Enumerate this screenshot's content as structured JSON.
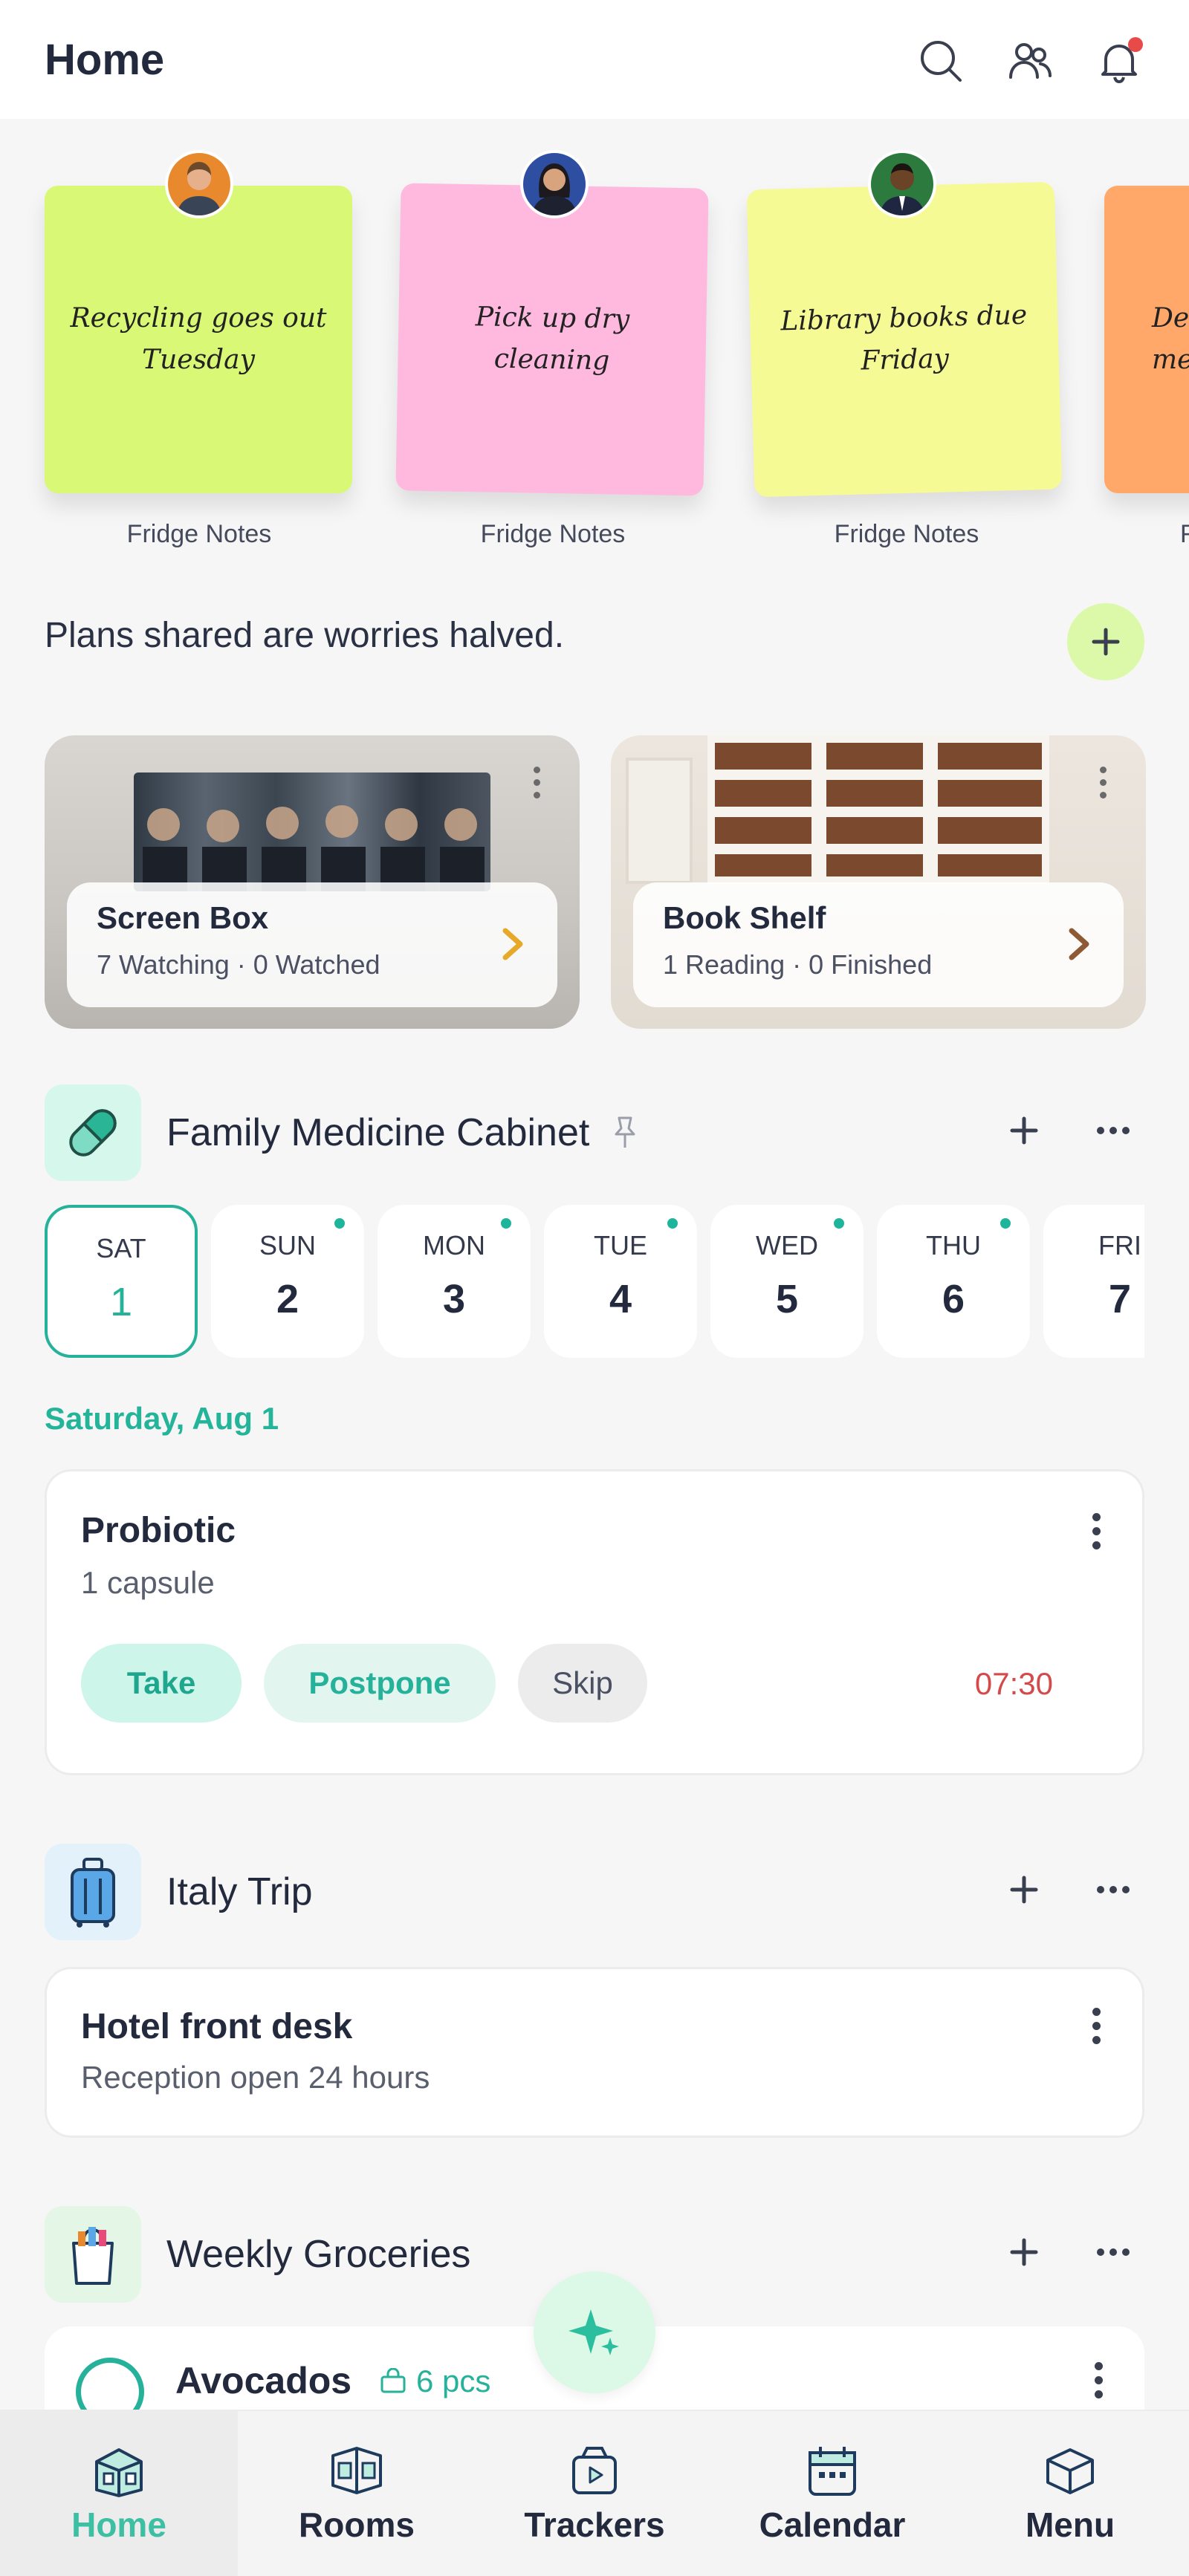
{
  "header": {
    "title": "Home"
  },
  "fridge_notes": [
    {
      "text": "Recycling goes out Tuesday",
      "caption": "Fridge Notes",
      "color": "#d9f876"
    },
    {
      "text": "Pick up dry cleaning",
      "caption": "Fridge Notes",
      "color": "#ffb9de"
    },
    {
      "text": "Library books due Friday",
      "caption": "Fridge Notes",
      "color": "#f6fa95"
    },
    {
      "text": "Dentist me",
      "caption": "F",
      "color": "#ffa86a"
    }
  ],
  "tagline": "Plans shared are worries halved.",
  "media_cards": [
    {
      "title": "Screen Box",
      "subtitle": "7 Watching · 0 Watched",
      "chevron_color": "#e6a92a"
    },
    {
      "title": "Book Shelf",
      "subtitle": "1 Reading · 0 Finished",
      "chevron_color": "#8d5a35"
    }
  ],
  "medicine": {
    "title": "Family Medicine Cabinet",
    "days": [
      {
        "name": "SAT",
        "num": "1"
      },
      {
        "name": "SUN",
        "num": "2"
      },
      {
        "name": "MON",
        "num": "3"
      },
      {
        "name": "TUE",
        "num": "4"
      },
      {
        "name": "WED",
        "num": "5"
      },
      {
        "name": "THU",
        "num": "6"
      },
      {
        "name": "FRI",
        "num": "7"
      }
    ],
    "selected_date": "Saturday, Aug 1",
    "item": {
      "name": "Probiotic",
      "dose": "1 capsule",
      "take_label": "Take",
      "postpone_label": "Postpone",
      "skip_label": "Skip",
      "time": "07:30"
    }
  },
  "trip": {
    "title": "Italy Trip",
    "card_title": "Hotel front desk",
    "card_sub": "Reception open 24 hours"
  },
  "groceries": {
    "title": "Weekly Groceries",
    "item_name": "Avocados",
    "item_qty": "6 pcs"
  },
  "bottom_nav": [
    {
      "label": "Home",
      "icon": "home-icon"
    },
    {
      "label": "Rooms",
      "icon": "rooms-icon"
    },
    {
      "label": "Trackers",
      "icon": "trackers-icon"
    },
    {
      "label": "Calendar",
      "icon": "calendar-icon"
    },
    {
      "label": "Menu",
      "icon": "menu-icon"
    }
  ],
  "colors": {
    "accent": "#26b29a",
    "danger": "#d44a4a"
  }
}
